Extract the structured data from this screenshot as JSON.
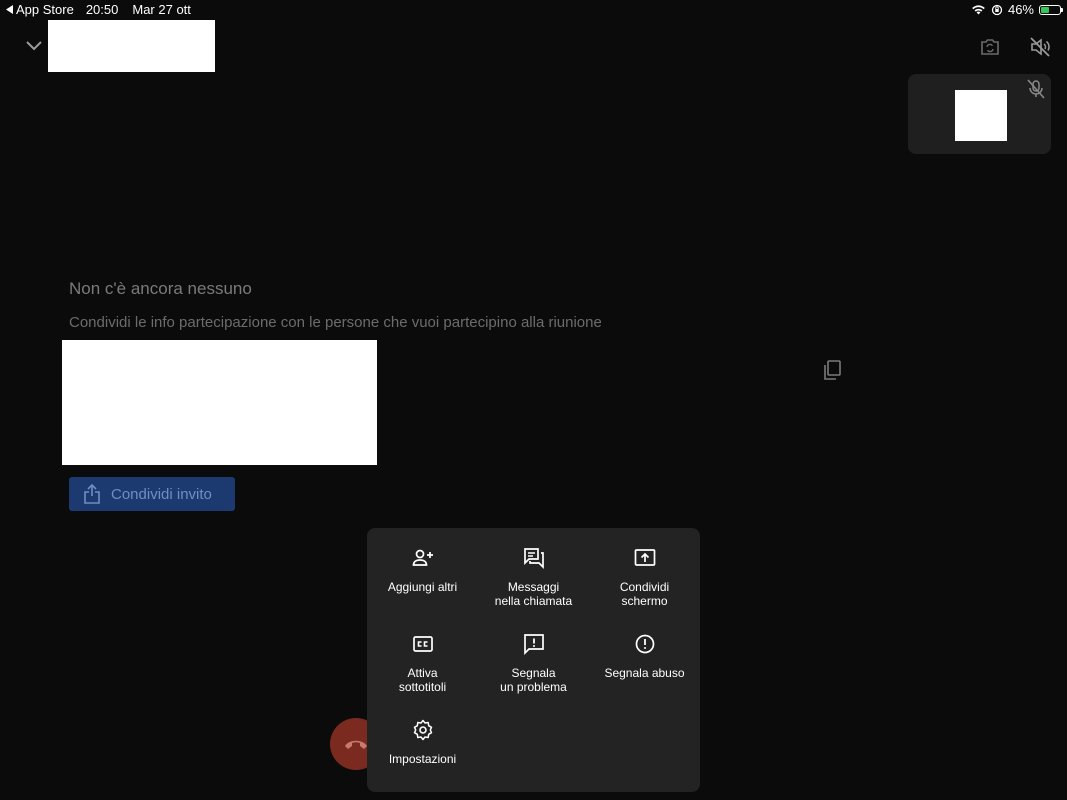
{
  "status_bar": {
    "back_app": "App Store",
    "time": "20:50",
    "date": "Mar 27 ott",
    "battery": "46%",
    "battery_level": 0.46,
    "battery_color": "#35c759"
  },
  "content": {
    "empty_title": "Non c'è ancora nessuno",
    "share_info": "Condividi le info partecipazione con le persone che vuoi partecipino alla riunione",
    "invite_button": "Condividi invito"
  },
  "menu": {
    "items": [
      {
        "label": "Aggiungi altri",
        "icon": "add-person-icon"
      },
      {
        "label": "Messaggi\nnella chiamata",
        "icon": "chat-icon"
      },
      {
        "label": "Condividi\nschermo",
        "icon": "present-screen-icon"
      },
      {
        "label": "Attiva\nsottotitoli",
        "icon": "closed-captions-icon"
      },
      {
        "label": "Segnala\nun problema",
        "icon": "report-problem-icon"
      },
      {
        "label": "Segnala abuso",
        "icon": "report-abuse-icon"
      },
      {
        "label": "Impostazioni",
        "icon": "settings-icon"
      }
    ]
  },
  "colors": {
    "background": "#0b0b0b",
    "menu_background": "#232323",
    "invite_button": "#1c3a70",
    "end_call": "#7b2a20"
  }
}
